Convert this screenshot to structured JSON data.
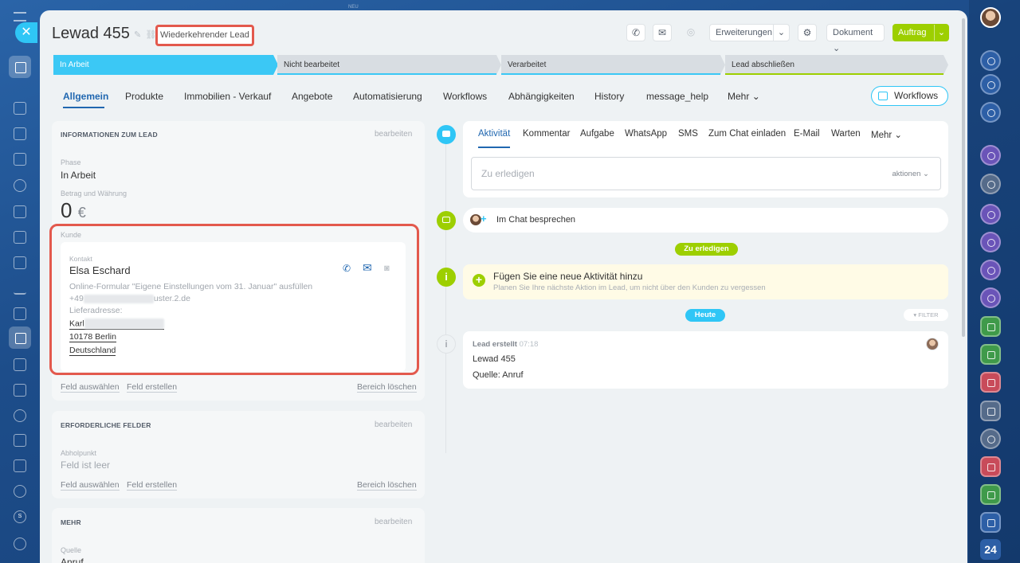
{
  "header": {
    "title": "Lewad 455",
    "recurring_badge": "Wiederkehrender Lead",
    "buttons": {
      "extensions": "Erweiterungen",
      "document": "Dokument",
      "order": "Auftrag"
    }
  },
  "window_top_label": "NEU",
  "stages": [
    {
      "label": "In Arbeit",
      "color": "#3bc8f5",
      "active": true
    },
    {
      "label": "Nicht bearbeitet",
      "color": "#d8dde2",
      "active": false
    },
    {
      "label": "Verarbeitet",
      "color": "#d8dde2",
      "active": false
    },
    {
      "label": "Lead abschließen",
      "color": "#d8dde2",
      "active": false
    }
  ],
  "tabs": [
    {
      "label": "Allgemein"
    },
    {
      "label": "Produkte"
    },
    {
      "label": "Immobilien - Verkauf"
    },
    {
      "label": "Angebote"
    },
    {
      "label": "Automatisierung"
    },
    {
      "label": "Workflows"
    },
    {
      "label": "Abhängigkeiten"
    },
    {
      "label": "History"
    },
    {
      "label": "message_help"
    },
    {
      "label": "Mehr"
    }
  ],
  "workflows_button": "Workflows",
  "lead_info": {
    "section_title": "INFORMATIONEN ZUM LEAD",
    "edit": "bearbeiten",
    "phase_label": "Phase",
    "phase_value": "In Arbeit",
    "amount_label": "Betrag und Währung",
    "amount_value": "0",
    "currency": "€",
    "customer_label": "Kunde",
    "contact_label": "Kontakt",
    "contact_name": "Elsa Eschard",
    "contact_source": "Online-Formular \"Eigene Einstellungen vom 31. Januar\" ausfüllen",
    "phone_prefix": "+49",
    "email_suffix": "uster.2.de",
    "delivery_label": "Lieferadresse:",
    "street_prefix": "Karl",
    "zip_city": "10178 Berlin",
    "country": "Deutschland",
    "select_field": "Feld auswählen",
    "create_field": "Feld erstellen",
    "delete_section": "Bereich löschen"
  },
  "required_fields": {
    "section_title": "ERFORDERLICHE FELDER",
    "edit": "bearbeiten",
    "pickup_label": "Abholpunkt",
    "pickup_value": "Feld ist leer",
    "select_field": "Feld auswählen",
    "create_field": "Feld erstellen",
    "delete_section": "Bereich löschen"
  },
  "more_section": {
    "section_title": "MEHR",
    "edit": "bearbeiten",
    "source_label": "Quelle",
    "source_value": "Anruf"
  },
  "activity": {
    "tabs": [
      "Aktivität",
      "Kommentar",
      "Aufgabe",
      "WhatsApp",
      "SMS",
      "Zum Chat einladen",
      "E-Mail",
      "Warten",
      "Mehr"
    ],
    "todo_placeholder": "Zu erledigen",
    "actions": "aktionen",
    "chat_discuss": "Im Chat besprechen",
    "todo_pill": "Zu erledigen",
    "add_activity_title": "Fügen Sie eine neue Aktivität hinzu",
    "add_activity_sub": "Planen Sie Ihre nächste Aktion im Lead, um nicht über den Kunden zu vergessen",
    "today_pill": "Heute",
    "filter": "FILTER",
    "created_title": "Lead erstellt",
    "created_time": "07:18",
    "created_name": "Lewad 455",
    "created_source": "Quelle: Anruf"
  },
  "colors": {
    "accent_blue": "#2067b0",
    "stage_active": "#3bc8f5",
    "green": "#9dcf00",
    "highlight_red": "#e3594d"
  },
  "right_bar_label": "24"
}
